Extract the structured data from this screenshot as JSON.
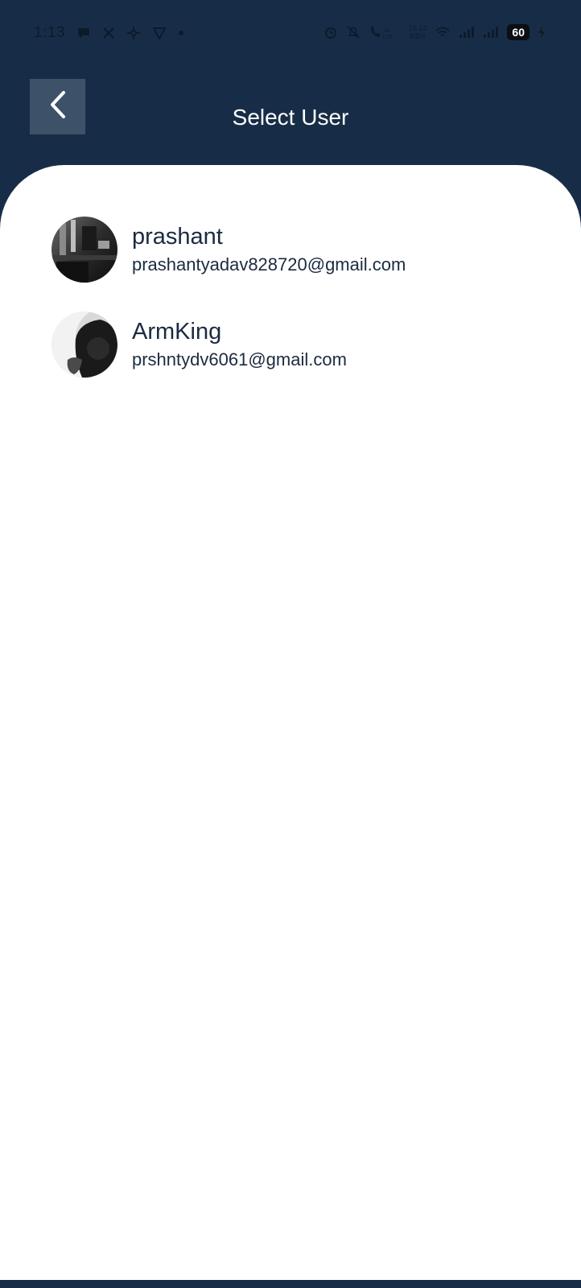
{
  "status_bar": {
    "time": "1:13",
    "net_speed_value": "15.12",
    "net_speed_unit": "KB/s",
    "battery": "60",
    "icons": [
      "chat-bubble-icon",
      "x-icon",
      "pinwheel-icon",
      "shield-v-icon",
      "dot-icon",
      "alarm-icon",
      "bell-off-icon",
      "volte-call-icon",
      "wifi-icon",
      "signal-icon",
      "signal-icon",
      "battery-icon",
      "charging-icon"
    ]
  },
  "header": {
    "title": "Select User",
    "back_icon": "chevron-left-icon"
  },
  "users": [
    {
      "name": "prashant",
      "email": "prashantyadav828720@gmail.com",
      "avatar": "user-photo"
    },
    {
      "name": "ArmKing",
      "email": "prshntydv6061@gmail.com",
      "avatar": "user-photo"
    }
  ],
  "colors": {
    "header_bg": "#172d47",
    "back_button_bg": "#3d5269",
    "card_bg": "#ffffff",
    "text_primary": "#1b2b40"
  }
}
